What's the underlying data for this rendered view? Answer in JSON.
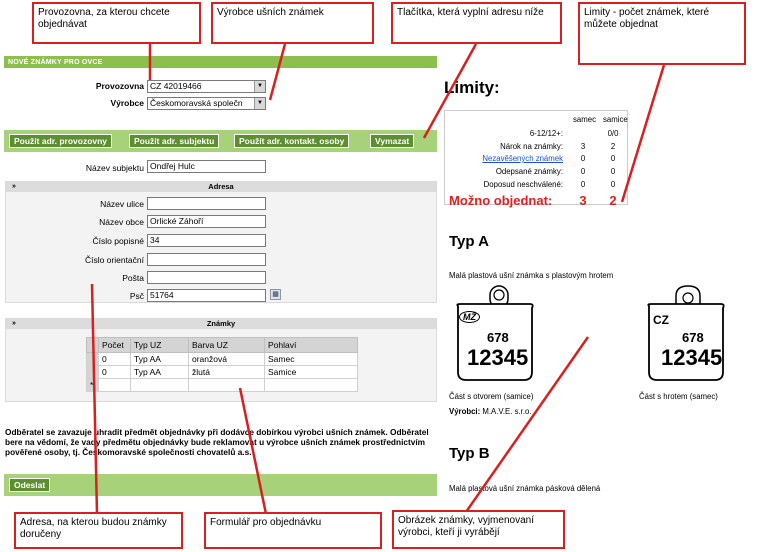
{
  "callouts": {
    "provozovna": "Provozovna, za kterou chcete objednávat",
    "vyrobce": "Výrobce ušních známek",
    "tlacitka": "Tlačítka, která vyplní adresu níže",
    "limity": "Limity - počet známek, které můžete objednat",
    "adresa": "Adresa, na kterou budou známky doručeny",
    "formular": "Formulář pro objednávku",
    "obrazek": "Obrázek známky, vyjmenovaní výrobci, kteří ji vyrábějí"
  },
  "form": {
    "title": "Nové známky pro ovce",
    "provozovna_label": "Provozovna",
    "provozovna_value": "CZ 42019466",
    "vyrobce_label": "Výrobce",
    "vyrobce_value": "Českomoravská společn",
    "buttons": {
      "provozovna": "Použít adr. provozovny",
      "subjekt": "Použít adr. subjektu",
      "kontakt": "Použít adr. kontakt. osoby",
      "vymazat": "Vymazat"
    },
    "nazev_subjektu_label": "Název subjektu",
    "nazev_subjektu_value": "Ondřej Hulc",
    "adresa_title": "Adresa",
    "collapse_glyph": "»",
    "fields": {
      "ulice_label": "Název ulice",
      "ulice_value": "",
      "obec_label": "Název obce",
      "obec_value": "Orlické Záhoří",
      "popisne_label": "Číslo popisné",
      "popisne_value": "34",
      "orientacni_label": "Číslo orientační",
      "orientacni_value": "",
      "posta_label": "Pošta",
      "posta_value": "",
      "psc_label": "Psč",
      "psc_value": "51764"
    },
    "znamky_title": "Známky",
    "table": {
      "headers": [
        "Počet",
        "Typ UZ",
        "Barva UZ",
        "Pohlaví"
      ],
      "rows": [
        [
          "0",
          "Typ AA",
          "oranžová",
          "Samec"
        ],
        [
          "0",
          "Typ AA",
          "žlutá",
          "Samice"
        ]
      ],
      "new_row_marker": "*"
    },
    "note": "Odběratel se zavazuje uhradit předmět objednávky při dodávce dobírkou výrobci ušních známek. Odběratel bere na vědomí, že vady předmětu objednávky bude reklamovat u výrobce ušních známek prostřednictvím pověřené osoby, tj. Českomoravské společnosti chovatelů a.s.",
    "submit": "Odeslat"
  },
  "limity": {
    "title": "Limity:",
    "col_samec": "samec",
    "col_samice": "samice",
    "rows": [
      {
        "label": "6-12/12+:",
        "samec": "",
        "samice": "0/0"
      },
      {
        "label": "Nárok na známky:",
        "samec": "3",
        "samice": "2"
      },
      {
        "label": "Nezavěšených známek",
        "samec": "0",
        "samice": "0"
      },
      {
        "label": "Odepsané známky:",
        "samec": "0",
        "samice": "0"
      },
      {
        "label": "Doposud neschválené:",
        "samec": "0",
        "samice": "0"
      }
    ],
    "mozno_label": "Možno objednat:",
    "mozno_samec": "3",
    "mozno_samice": "2"
  },
  "typ_a": {
    "title": "Typ A",
    "desc": "Malá plastová ušní známka s plastovým hrotem",
    "tag1_logo": "MŽ",
    "tag1_small": "678",
    "tag1_big": "12345",
    "tag2_logo": "CZ",
    "tag2_small": "678",
    "tag2_big": "12345",
    "caption1": "Část s otvorem (samice)",
    "caption2": "Část s hrotem (samec)",
    "vyrobci_label": "Výrobci:",
    "vyrobci_value": "M.A.V.E. s.r.o."
  },
  "typ_b": {
    "title": "Typ B",
    "desc": "Malá plastová ušní známka pásková dělená"
  }
}
